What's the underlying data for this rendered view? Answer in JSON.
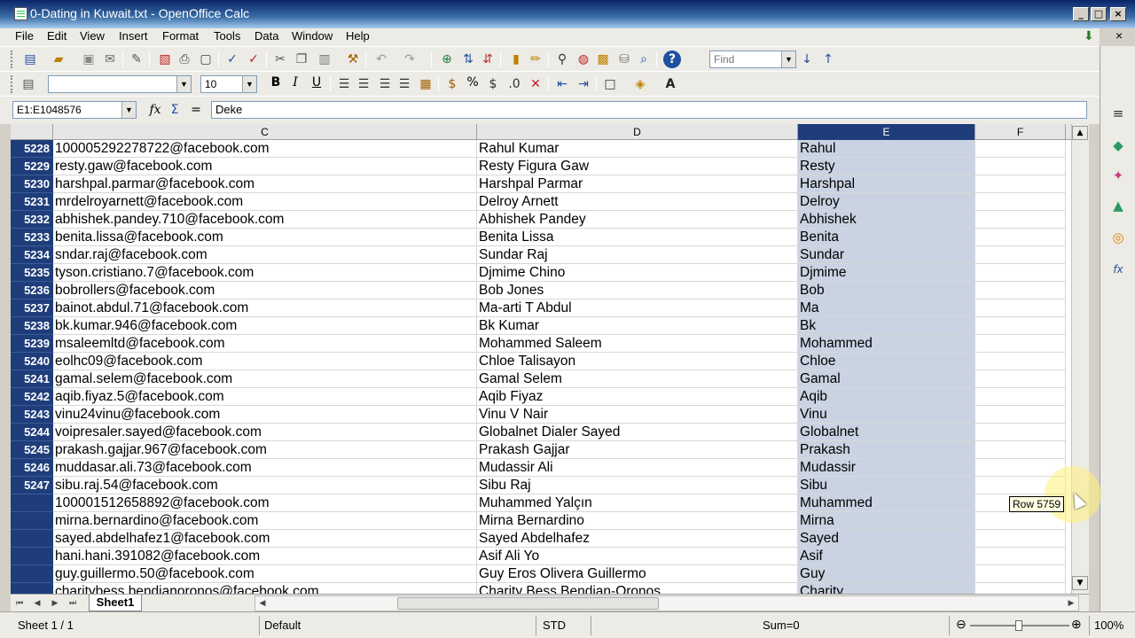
{
  "window": {
    "title": "0-Dating in Kuwait.txt - OpenOffice Calc",
    "minimize": "_",
    "maximize": "□",
    "close": "×"
  },
  "menu": [
    "File",
    "Edit",
    "View",
    "Insert",
    "Format",
    "Tools",
    "Data",
    "Window",
    "Help"
  ],
  "toolbar": {
    "find_placeholder": "Find",
    "style_value": "",
    "font_size": "10",
    "bold": "B",
    "italic": "I",
    "underline": "U",
    "percent": "%",
    "fx": "fx",
    "sum": "Σ",
    "equals": "="
  },
  "formula_bar": {
    "name_box": "E1:E1048576",
    "content": "Deke"
  },
  "columns": {
    "C": "C",
    "D": "D",
    "E": "E",
    "F": "F",
    "selected": "E"
  },
  "rows": [
    {
      "num": "5228",
      "c": "100005292278722@facebook.com",
      "d": "Rahul Kumar",
      "e": "Rahul"
    },
    {
      "num": "5229",
      "c": "resty.gaw@facebook.com",
      "d": "Resty Figura Gaw",
      "e": "Resty"
    },
    {
      "num": "5230",
      "c": "harshpal.parmar@facebook.com",
      "d": "Harshpal Parmar",
      "e": "Harshpal"
    },
    {
      "num": "5231",
      "c": "mrdelroyarnett@facebook.com",
      "d": "Delroy Arnett",
      "e": "Delroy"
    },
    {
      "num": "5232",
      "c": "abhishek.pandey.710@facebook.com",
      "d": "Abhishek Pandey",
      "e": "Abhishek"
    },
    {
      "num": "5233",
      "c": "benita.lissa@facebook.com",
      "d": "Benita Lissa",
      "e": "Benita"
    },
    {
      "num": "5234",
      "c": "sndar.raj@facebook.com",
      "d": "Sundar Raj",
      "e": "Sundar"
    },
    {
      "num": "5235",
      "c": "tyson.cristiano.7@facebook.com",
      "d": "Djmime Chino",
      "e": "Djmime"
    },
    {
      "num": "5236",
      "c": "bobrollers@facebook.com",
      "d": "Bob Jones",
      "e": "Bob"
    },
    {
      "num": "5237",
      "c": "bainot.abdul.71@facebook.com",
      "d": "Ma-arti T Abdul",
      "e": "Ma"
    },
    {
      "num": "5238",
      "c": "bk.kumar.946@facebook.com",
      "d": "Bk Kumar",
      "e": "Bk"
    },
    {
      "num": "5239",
      "c": "msaleemltd@facebook.com",
      "d": "Mohammed Saleem",
      "e": "Mohammed"
    },
    {
      "num": "5240",
      "c": "eolhc09@facebook.com",
      "d": "Chloe Talisayon",
      "e": "Chloe"
    },
    {
      "num": "5241",
      "c": "gamal.selem@facebook.com",
      "d": "Gamal Selem",
      "e": "Gamal"
    },
    {
      "num": "5242",
      "c": "aqib.fiyaz.5@facebook.com",
      "d": "Aqib Fiyaz",
      "e": "Aqib"
    },
    {
      "num": "5243",
      "c": "vinu24vinu@facebook.com",
      "d": "Vinu V Nair",
      "e": "Vinu"
    },
    {
      "num": "5244",
      "c": "voipresaler.sayed@facebook.com",
      "d": "Globalnet Dialer Sayed",
      "e": "Globalnet"
    },
    {
      "num": "5245",
      "c": "prakash.gajjar.967@facebook.com",
      "d": "Prakash Gajjar",
      "e": "Prakash"
    },
    {
      "num": "5246",
      "c": "muddasar.ali.73@facebook.com",
      "d": "Mudassir Ali",
      "e": "Mudassir"
    },
    {
      "num": "5247",
      "c": "sibu.raj.54@facebook.com",
      "d": "Sibu Raj",
      "e": "Sibu"
    },
    {
      "num": "",
      "c": "100001512658892@facebook.com",
      "d": "Muhammed Yalçın",
      "e": "Muhammed"
    },
    {
      "num": "",
      "c": "mirna.bernardino@facebook.com",
      "d": "Mirna Bernardino",
      "e": "Mirna"
    },
    {
      "num": "",
      "c": "sayed.abdelhafez1@facebook.com",
      "d": "Sayed Abdelhafez",
      "e": "Sayed"
    },
    {
      "num": "",
      "c": "hani.hani.391082@facebook.com",
      "d": "Asif Ali Yo",
      "e": "Asif"
    },
    {
      "num": "",
      "c": "guy.guillermo.50@facebook.com",
      "d": "Guy Eros Olivera Guillermo",
      "e": "Guy"
    },
    {
      "num": "",
      "c": "charitybess.bendianoronos@facebook.com",
      "d": "Charity Bess Bendian-Oronos",
      "e": "Charity"
    }
  ],
  "tooltip": "Row 5759",
  "sheet_tab": "Sheet1",
  "status": {
    "sheet": "Sheet 1 / 1",
    "page_style": "Default",
    "mode": "STD",
    "sum": "Sum=0",
    "zoom": "100%",
    "zoom_minus": "⊖",
    "zoom_plus": "⊕"
  },
  "colors": {
    "selection": "#1f3d7a",
    "selected_column_fill": "#c9d3e2",
    "title_gradient_start": "#0a246a"
  }
}
